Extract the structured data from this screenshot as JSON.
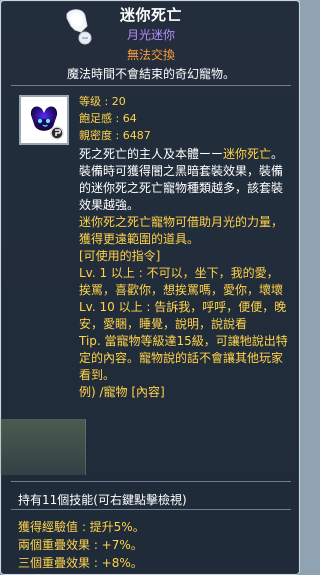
{
  "item": {
    "title": "迷你死亡",
    "subtitle": "月光迷你",
    "untradeable": "無法交換",
    "tagline": "魔法時間不會結束的奇幻寵物。",
    "stats": [
      "等级 : 20",
      "飽足感 : 64",
      "親密度 : 6487"
    ]
  },
  "description": [
    {
      "text": "死之死亡的主人及本體ーー",
      "color": "white"
    },
    {
      "text": "迷你死亡",
      "color": "yellow",
      "inline": true
    },
    {
      "text": "。",
      "color": "white",
      "inline": true
    }
  ],
  "para2": "裝備時可獲得闇之黑暗套裝效果，裝備的迷你死之死亡寵物種類越多，該套裝效果越強。",
  "para3": "迷你死之死亡寵物可借助月光的力量，獲得更遠範圍的道具。",
  "commands": {
    "title": "[可使用的指令]",
    "lines": [
      "Lv. 1 以上 : 不可以，坐下，我的愛，挨罵，喜歡你，想挨罵嗎，愛你，壞壞",
      "Lv. 10 以上 : 告訴我，呼呼，便便，晚安，愛睏，睡覺，說明，說說看",
      "Tip. 當寵物等級達15級，可讓牠說出特定的內容。寵物說的話不會讓其他玩家看到。",
      "例) /寵物 [內容]"
    ]
  },
  "skills": "持有11個技能(可右鍵點擊檢視)",
  "bottom": {
    "exp": "獲得經驗值 : 提升5%。",
    "double": "兩個重疊效果 : +7%。",
    "triple": "三個重疊效果 : +8%。"
  },
  "colors": {
    "title": "#ffffff",
    "subtitle": "#b38cff",
    "untradeable": "#ff9a3b",
    "yellow": "#ffd34a",
    "white": "#ffffff",
    "background": "#18222f"
  }
}
